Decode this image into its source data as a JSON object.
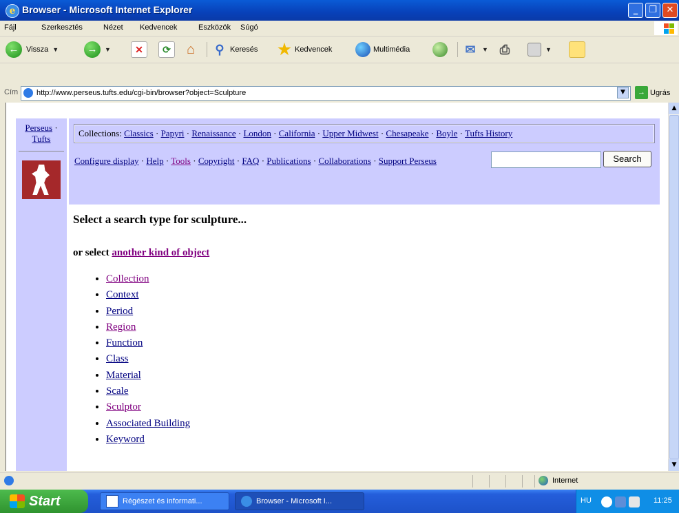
{
  "window": {
    "title": "Browser - Microsoft Internet Explorer"
  },
  "menu": [
    "Fájl",
    "Szerkesztés",
    "Nézet",
    "Kedvencek",
    "Eszközök",
    "Súgó"
  ],
  "toolbar": {
    "back": "Vissza",
    "search": "Keresés",
    "favorites": "Kedvencek",
    "media": "Multimédia"
  },
  "address": {
    "label": "Cím",
    "url": "http://www.perseus.tufts.edu/cgi-bin/browser?object=Sculpture",
    "go": "Ugrás"
  },
  "page": {
    "left_link_1": "Perseus",
    "left_link_2": "Tufts",
    "collections_label": "Collections:",
    "collections": [
      "Classics",
      "Papyri",
      "Renaissance",
      "London",
      "California",
      "Upper Midwest",
      "Chesapeake",
      "Boyle",
      "Tufts History"
    ],
    "tools_links": [
      "Configure display",
      "Help",
      "Tools",
      "Copyright",
      "FAQ",
      "Publications",
      "Collaborations",
      "Support Perseus"
    ],
    "search_button": "Search",
    "heading": "Select a search type for sculpture...",
    "or_select": "or select",
    "another_kind": "another kind of object",
    "search_types": [
      "Collection",
      "Context",
      "Period",
      "Region",
      "Function",
      "Class",
      "Material",
      "Scale",
      "Sculptor",
      "Associated Building",
      "Keyword"
    ]
  },
  "status": {
    "zone": "Internet"
  },
  "taskbar": {
    "start": "Start",
    "tasks": [
      "Régészet és informati...",
      "Browser - Microsoft I..."
    ],
    "lang": "HU",
    "clock": "11:25"
  }
}
